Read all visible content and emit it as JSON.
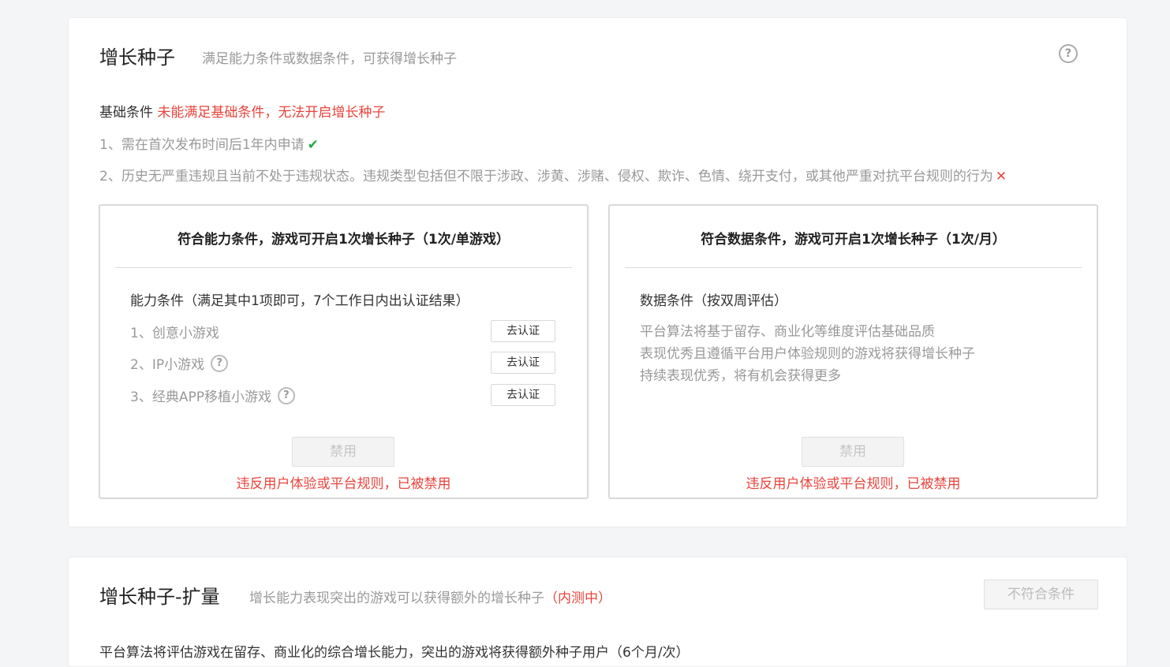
{
  "growth_seed": {
    "title": "增长种子",
    "subtitle": "满足能力条件或数据条件，可获得增长种子",
    "help_icon": "question-circle-icon",
    "basic": {
      "label": "基础条件",
      "warning": "未能满足基础条件，无法开启增长种子",
      "items": [
        {
          "text": "1、需在首次发布时间后1年内申请",
          "status": "✔"
        },
        {
          "text": "2、历史无严重违规且当前不处于违规状态。违规类型包括但不限于涉政、涉黄、涉赌、侵权、欺诈、色情、绕开支付，或其他严重对抗平台规则的行为",
          "status": "✕"
        }
      ]
    },
    "ability_box": {
      "title": "符合能力条件，游戏可开启1次增长种子（1次/单游戏）",
      "subtitle": "能力条件（满足其中1项即可，7个工作日内出认证结果）",
      "items": [
        {
          "text": "1、创意小游戏",
          "button": "去认证"
        },
        {
          "text": "2、IP小游戏",
          "button": "去认证"
        },
        {
          "text": "3、经典APP移植小游戏",
          "button": "去认证"
        }
      ],
      "disabled_button": "禁用",
      "ban_text": "违反用户体验或平台规则，已被禁用"
    },
    "data_box": {
      "title": "符合数据条件，游戏可开启1次增长种子（1次/月）",
      "subtitle": "数据条件（按双周评估）",
      "desc_lines": [
        "平台算法将基于留存、商业化等维度评估基础品质",
        "表现优秀且遵循平台用户体验规则的游戏将获得增长种子",
        "持续表现优秀，将有机会获得更多"
      ],
      "disabled_button": "禁用",
      "ban_text": "违反用户体验或平台规则，已被禁用"
    }
  },
  "expansion": {
    "title": "增长种子-扩量",
    "subtitle": "增长能力表现突出的游戏可以获得额外的增长种子",
    "tag": "（内测中）",
    "button": "不符合条件",
    "body": "平台算法将评估游戏在留存、商业化的综合增长能力，突出的游戏将获得额外种子用户（6个月/次）"
  },
  "colors": {
    "warning": "#e8453c",
    "success": "#22a745",
    "muted": "#999999"
  }
}
